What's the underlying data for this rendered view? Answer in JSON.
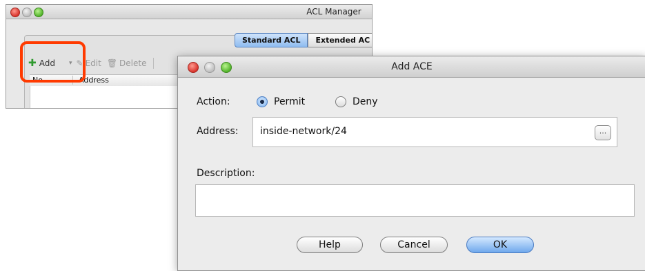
{
  "acl_manager": {
    "title": "ACL Manager",
    "tabs": [
      "Standard ACL",
      "Extended AC"
    ],
    "toolbar": {
      "add": "Add",
      "edit": "Edit",
      "delete": "Delete"
    },
    "columns": [
      "No",
      "Address"
    ]
  },
  "dialog": {
    "title": "Add ACE",
    "action_label": "Action:",
    "permit": "Permit",
    "deny": "Deny",
    "selected_action": "Permit",
    "address_label": "Address:",
    "address_value": "inside-network/24",
    "browse": "...",
    "description_label": "Description:",
    "description_value": "",
    "buttons": {
      "help": "Help",
      "cancel": "Cancel",
      "ok": "OK"
    }
  }
}
